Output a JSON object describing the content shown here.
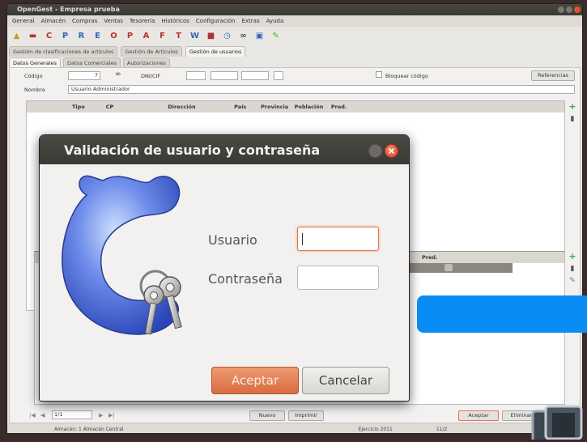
{
  "window": {
    "title": "OpenGest - Empresa prueba"
  },
  "menu": [
    "General",
    "Almacén",
    "Compras",
    "Ventas",
    "Tesorería",
    "Históricos",
    "Configuración",
    "Extras",
    "Ayuda"
  ],
  "toolbar_icons": [
    {
      "icon": "triangle-icon",
      "glyph": "▲"
    },
    {
      "icon": "doc-icon",
      "glyph": "▬"
    },
    {
      "icon": "c-icon",
      "glyph": "C"
    },
    {
      "icon": "p-icon",
      "glyph": "P"
    },
    {
      "icon": "r-icon",
      "glyph": "R"
    },
    {
      "icon": "e-icon",
      "glyph": "E"
    },
    {
      "icon": "o-icon",
      "glyph": "O"
    },
    {
      "icon": "p2-icon",
      "glyph": "P"
    },
    {
      "icon": "a-icon",
      "glyph": "A"
    },
    {
      "icon": "f-icon",
      "glyph": "F"
    },
    {
      "icon": "t-icon",
      "glyph": "T"
    },
    {
      "icon": "w-icon",
      "glyph": "W"
    },
    {
      "icon": "book-icon",
      "glyph": "■"
    },
    {
      "icon": "clock-icon",
      "glyph": "◷"
    },
    {
      "icon": "binoculars-icon",
      "glyph": "∞"
    },
    {
      "icon": "monitor-icon",
      "glyph": "▣"
    },
    {
      "icon": "tools-icon",
      "glyph": "✎"
    }
  ],
  "tabs_top": [
    "Gestión de clasificaciones de artículos",
    "Gestión de Artículos",
    "Gestión de usuarios"
  ],
  "tabs_inner": [
    "Datos Generales",
    "Datos Comerciales",
    "Autorizaciones"
  ],
  "form": {
    "codigo_label": "Código",
    "codigo_value": "7",
    "dni_label": "DNI/CIF",
    "bloquear_label": "Bloquear código",
    "referencias_btn": "Referencias",
    "nombre_label": "Nombre",
    "nombre_value": "Usuario Administrador"
  },
  "grid": {
    "columns": [
      "Tipo",
      "CP",
      "Dirección",
      "País",
      "Provincia",
      "Población",
      "Pred."
    ]
  },
  "grid2": {
    "columns": [
      "Pred."
    ]
  },
  "bottom": {
    "record_value": "1/1",
    "nuevo": "Nuevo",
    "imprimir": "Imprimir",
    "aceptar": "Aceptar",
    "eliminar": "Eliminar"
  },
  "statusbar": {
    "almacen": "Almacén: 1 Almacén Central",
    "ejercicio": "Ejercicio 2011",
    "num": "11/2"
  },
  "dialog": {
    "title": "Validación de usuario y contraseña",
    "usuario_label": "Usuario",
    "usuario_value": "",
    "password_label": "Contraseña",
    "password_value": "",
    "ok_label": "Aceptar",
    "cancel_label": "Cancelar"
  },
  "colors": {
    "accent": "#e0542c",
    "highlight_bar": "#0a8cf5"
  }
}
